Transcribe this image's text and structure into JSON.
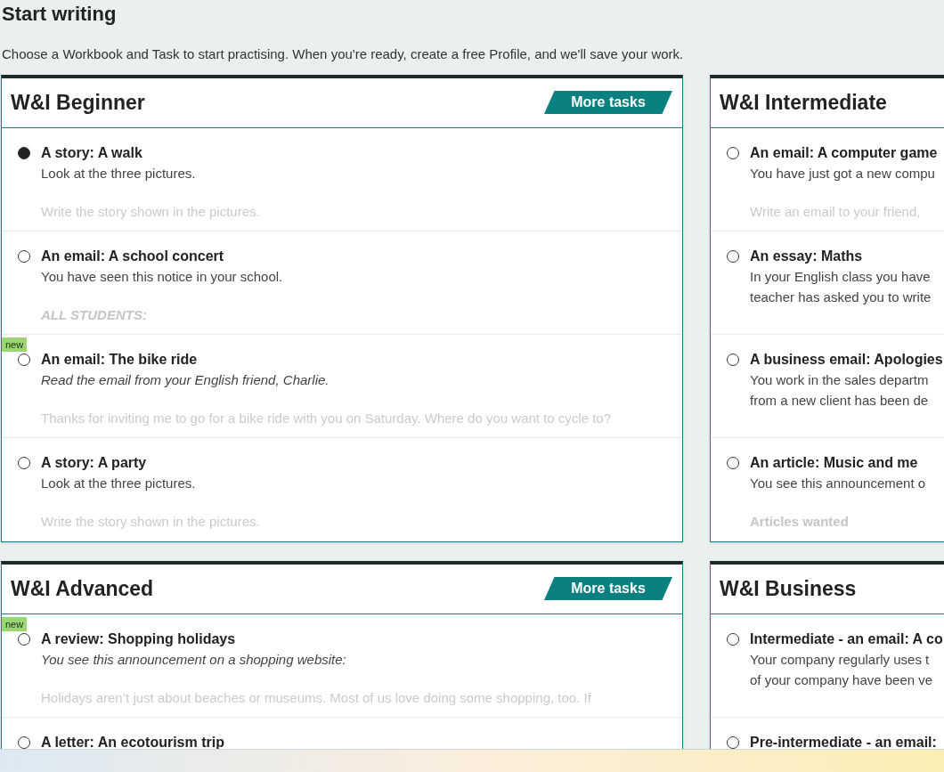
{
  "page": {
    "title": "Start writing",
    "intro": "Choose a Workbook and Task to start practising. When you're ready, create a free Profile, and we'll save your work."
  },
  "workbooks": [
    {
      "title": "W&I Beginner",
      "more_button": "More tasks",
      "tasks": [
        {
          "title": "A story: A walk",
          "selected": true,
          "description": {
            "kind": "plain",
            "lines": [
              "Look at the three pictures."
            ]
          },
          "preview": {
            "kind": "plain",
            "text": "Write the story shown in the pictures."
          }
        },
        {
          "title": "An email: A school concert",
          "selected": false,
          "description": {
            "kind": "plain",
            "lines": [
              "You have seen this notice in your school."
            ]
          },
          "preview": {
            "kind": "heading",
            "text": "ALL STUDENTS:"
          }
        },
        {
          "title": "An email: The bike ride",
          "selected": false,
          "badge": "new",
          "description": {
            "kind": "italic",
            "lines": [
              "Read the email from your English friend, Charlie."
            ]
          },
          "preview": {
            "kind": "plain",
            "text": "Thanks for inviting me to go for a bike ride with you on Saturday. Where do you want to cycle to?"
          }
        },
        {
          "title": "A story: A party",
          "selected": false,
          "description": {
            "kind": "plain",
            "lines": [
              "Look at the three pictures."
            ]
          },
          "preview": {
            "kind": "plain",
            "text": "Write the story shown in the pictures."
          }
        }
      ]
    },
    {
      "title": "W&I Intermediate",
      "tasks": [
        {
          "title": "An email: A computer game",
          "selected": false,
          "description": {
            "kind": "plain",
            "lines": [
              "You have just got a new compu"
            ]
          },
          "preview": {
            "kind": "plain",
            "text": "Write an email to your friend,"
          }
        },
        {
          "title": "An essay: Maths",
          "selected": false,
          "description": {
            "kind": "plain",
            "lines": [
              "In your English class you have",
              "teacher has asked you to write"
            ]
          }
        },
        {
          "title": "A business email: Apologies",
          "selected": false,
          "description": {
            "kind": "plain",
            "lines": [
              "You work in the sales departm",
              "from a new client has been de"
            ]
          }
        },
        {
          "title": "An article: Music and me",
          "selected": false,
          "description": {
            "kind": "plain",
            "lines": [
              "You see this announcement o"
            ]
          },
          "preview": {
            "kind": "bold",
            "text": "Articles wanted"
          }
        }
      ]
    },
    {
      "title": "W&I Advanced",
      "more_button": "More tasks",
      "tasks": [
        {
          "title": "A review: Shopping holidays",
          "selected": false,
          "badge": "new",
          "description": {
            "kind": "italic",
            "lines": [
              "You see this announcement on a shopping website:"
            ]
          },
          "preview": {
            "kind": "plain",
            "text": "Holidays aren’t just about beaches or museums. Most of us love doing some shopping, too. If"
          }
        },
        {
          "title": "A letter: An ecotourism trip",
          "selected": false
        }
      ]
    },
    {
      "title": "W&I Business",
      "tasks": [
        {
          "title": "Intermediate - an email: A co",
          "selected": false,
          "description": {
            "kind": "plain",
            "lines": [
              "Your company regularly uses t",
              "of your company have been ve"
            ]
          }
        },
        {
          "title": "Pre-intermediate - an email:",
          "selected": false
        }
      ]
    }
  ]
}
